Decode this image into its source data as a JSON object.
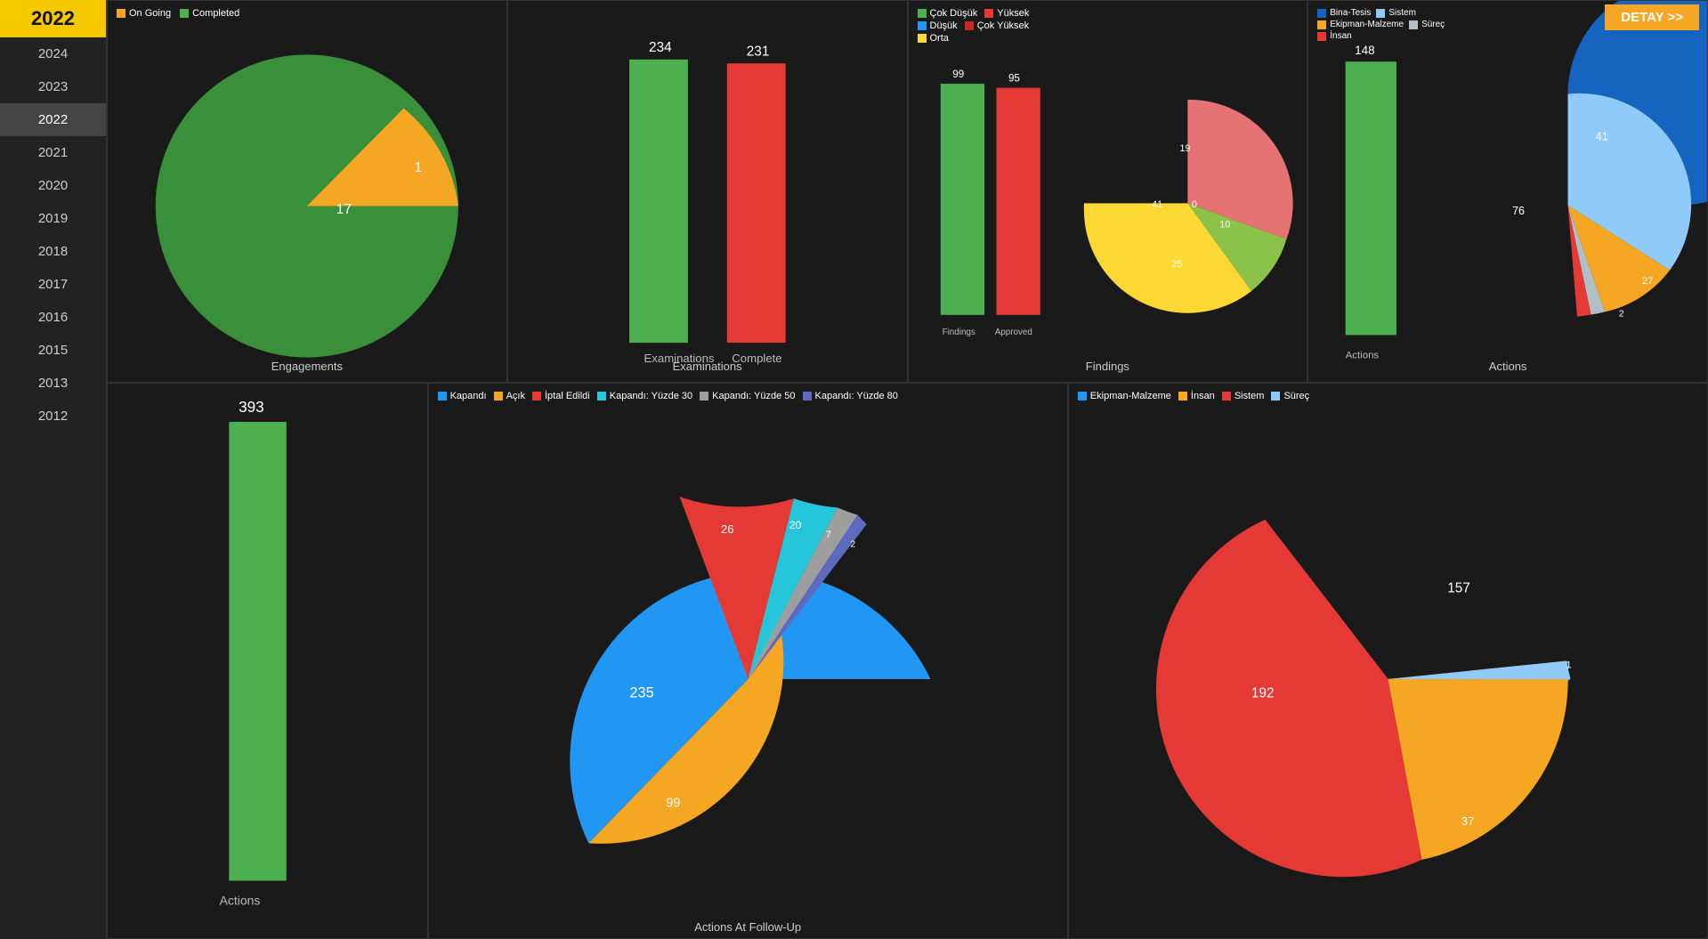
{
  "sidebar": {
    "title": "2022",
    "years": [
      {
        "label": "2024",
        "active": false
      },
      {
        "label": "2023",
        "active": false
      },
      {
        "label": "2022",
        "active": true
      },
      {
        "label": "2021",
        "active": false
      },
      {
        "label": "2020",
        "active": false
      },
      {
        "label": "2019",
        "active": false
      },
      {
        "label": "2018",
        "active": false
      },
      {
        "label": "2017",
        "active": false
      },
      {
        "label": "2016",
        "active": false
      },
      {
        "label": "2015",
        "active": false
      },
      {
        "label": "2013",
        "active": false
      },
      {
        "label": "2012",
        "active": false
      }
    ]
  },
  "detay_btn": "DETAY >>",
  "charts": {
    "engagements": {
      "title": "Engagements",
      "legend": [
        {
          "label": "On Going",
          "color": "#f5a623"
        },
        {
          "label": "Completed",
          "color": "#4caf50"
        }
      ],
      "pie": {
        "ongoing": {
          "value": 1,
          "color": "#f5a623"
        },
        "completed": {
          "value": 17,
          "color": "#3a8f3a"
        }
      }
    },
    "examinations_top": {
      "title": "Examinations",
      "bars": [
        {
          "label": "Examinations",
          "value": 234,
          "color": "#4caf50"
        },
        {
          "label": "Complete",
          "value": 231,
          "color": "#e53935"
        }
      ]
    },
    "findings_top": {
      "title": "Findings",
      "legend": [
        {
          "label": "Çok Düşük",
          "color": "#4caf50"
        },
        {
          "label": "Yüksek",
          "color": "#e53935"
        },
        {
          "label": "Düşük",
          "color": "#2196f3"
        },
        {
          "label": "Çok Yüksek",
          "color": "#c62828"
        },
        {
          "label": "Orta",
          "color": "#fdd835"
        }
      ],
      "bars": [
        {
          "label": "Findings",
          "value": 99,
          "color": "#4caf50"
        },
        {
          "label": "Approved",
          "value": 95,
          "color": "#e53935"
        }
      ],
      "pie": {
        "segments": [
          {
            "label": "Orta",
            "value": 41,
            "color": "#f5a623"
          },
          {
            "label": "Yüksek",
            "value": 19,
            "color": "#e57373"
          },
          {
            "label": "Çok Düşük",
            "value": 0,
            "color": "#4caf50"
          },
          {
            "label": "Düşük",
            "value": 10,
            "color": "#8bc34a"
          },
          {
            "label": "Çok Yüksek",
            "value": 25,
            "color": "#fdd835"
          }
        ]
      }
    },
    "actions_top": {
      "title": "Actions",
      "bar_value": 148,
      "legend": [
        {
          "label": "Bina-Tesis",
          "color": "#1565c0"
        },
        {
          "label": "Sistem",
          "color": "#90caf9"
        },
        {
          "label": "Ekipman-Malzeme",
          "color": "#f5a623"
        },
        {
          "label": "Süreç",
          "color": "#b0bec5"
        },
        {
          "label": "İnsan",
          "color": "#e53935"
        }
      ],
      "pie": {
        "segments": [
          {
            "label": "Bina-Tesis",
            "value": 76,
            "color": "#1565c0"
          },
          {
            "label": "Sistem",
            "value": 41,
            "color": "#90caf9"
          },
          {
            "label": "Ekipman-Malzeme",
            "value": 27,
            "color": "#f5a623"
          },
          {
            "label": "Süreç",
            "value": 2,
            "color": "#b0bec5"
          },
          {
            "label": "İnsan",
            "value": 2,
            "color": "#e53935"
          }
        ]
      }
    },
    "actions_bottom": {
      "title": "Actions",
      "bar_value": 393,
      "legend": [
        {
          "label": "Kapandı",
          "color": "#2196f3"
        },
        {
          "label": "Açık",
          "color": "#f5a623"
        },
        {
          "label": "İptal Edildi",
          "color": "#e53935"
        },
        {
          "label": "Kapandı: Yüzde 30",
          "color": "#26c6da"
        },
        {
          "label": "Kapandı: Yüzde 50",
          "color": "#9e9e9e"
        },
        {
          "label": "Kapandı: Yüzde 80",
          "color": "#5c6bc0"
        }
      ],
      "pie": {
        "segments": [
          {
            "label": "Kapandı",
            "value": 235,
            "color": "#2196f3"
          },
          {
            "label": "Açık",
            "value": 99,
            "color": "#f5a623"
          },
          {
            "label": "İptal Edildi",
            "value": 26,
            "color": "#e53935"
          },
          {
            "label": "Kapandı30",
            "value": 20,
            "color": "#26c6da"
          },
          {
            "label": "Kapandı50",
            "value": 7,
            "color": "#9e9e9e"
          },
          {
            "label": "Kapandı80",
            "value": 2,
            "color": "#5c6bc0"
          }
        ]
      }
    },
    "actions_followup": {
      "title": "Actions At Follow-Up",
      "legend": [
        {
          "label": "Ekipman-Malzeme",
          "color": "#2196f3"
        },
        {
          "label": "İnsan",
          "color": "#f5a623"
        },
        {
          "label": "Sistem",
          "color": "#e53935"
        },
        {
          "label": "Süreç",
          "color": "#90caf9"
        }
      ],
      "pie": {
        "segments": [
          {
            "label": "Sistem",
            "value": 157,
            "color": "#2196f3"
          },
          {
            "label": "Ekipman-Malzeme",
            "value": 192,
            "color": "#e53935"
          },
          {
            "label": "İnsan",
            "value": 37,
            "color": "#f5a623"
          },
          {
            "label": "Süreç",
            "value": 1,
            "color": "#90caf9"
          }
        ]
      }
    }
  }
}
